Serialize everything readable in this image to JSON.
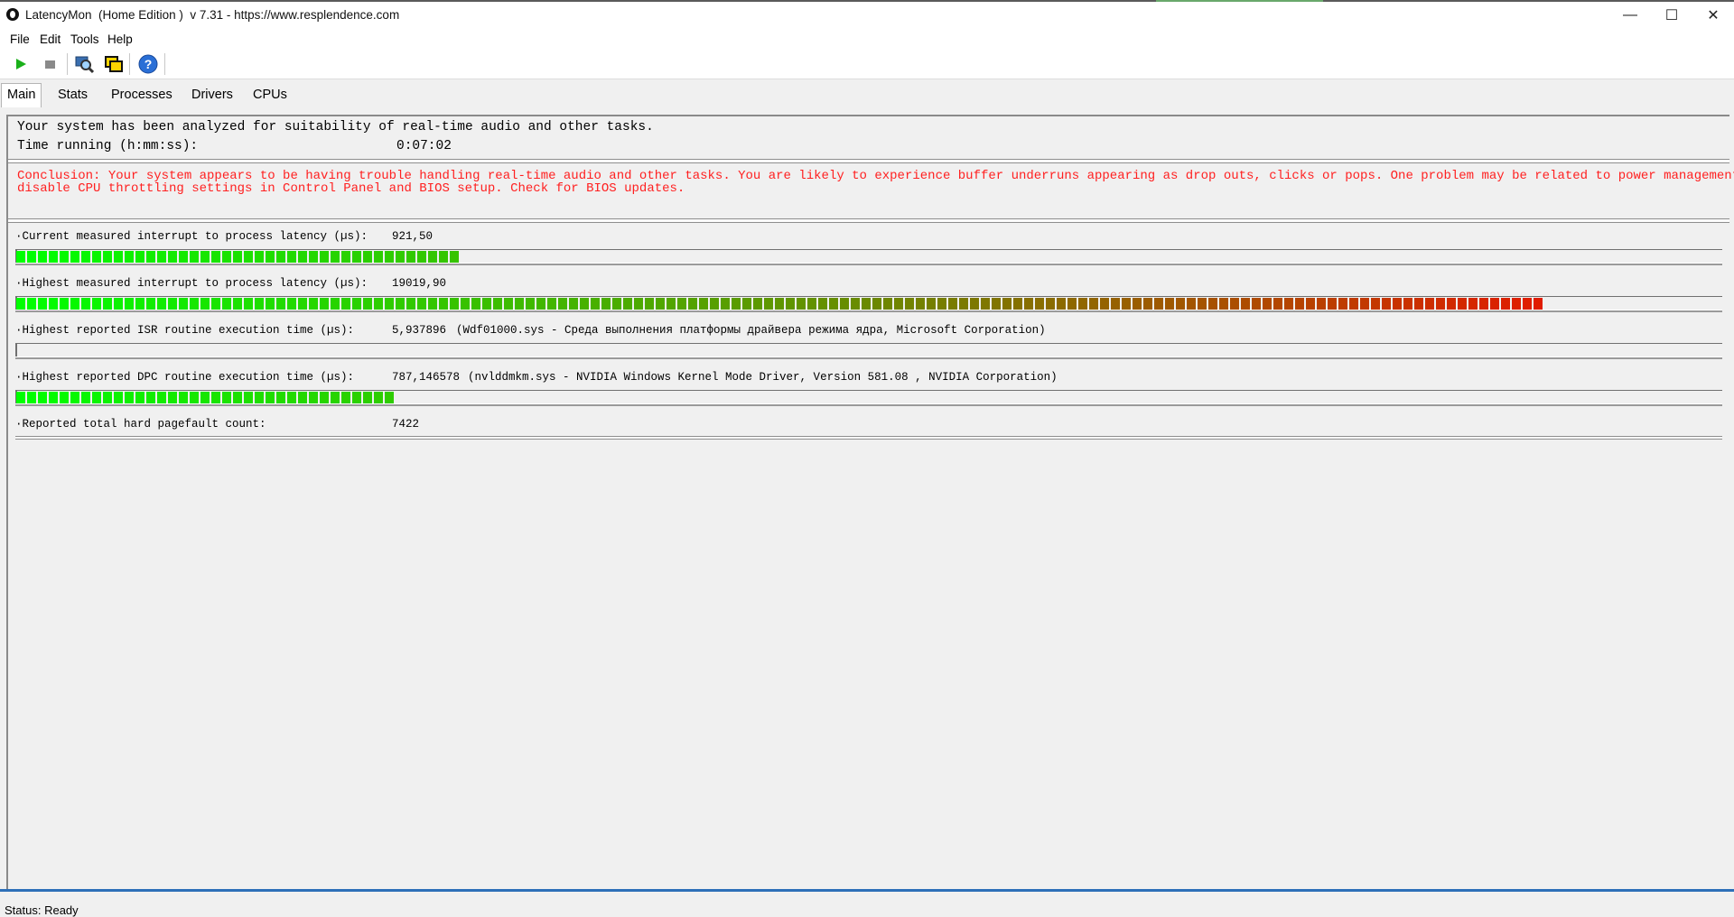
{
  "window": {
    "title": "LatencyMon  (Home Edition )  v 7.31 - https://www.resplendence.com",
    "minimize_glyph": "—",
    "maximize_glyph": "☐",
    "close_glyph": "✕"
  },
  "menu": {
    "items": [
      "File",
      "Edit",
      "Tools",
      "Help"
    ]
  },
  "toolbar": {
    "buttons": [
      "play-icon",
      "stop-icon",
      "magnifier-icon",
      "windows-icon",
      "help-icon"
    ],
    "colors": {
      "play": "#1ab01a",
      "stop": "#8a8a8a",
      "help": "#2a6fd6"
    }
  },
  "tabs": {
    "items": [
      "Main",
      "Stats",
      "Processes",
      "Drivers",
      "CPUs"
    ],
    "active": "Main"
  },
  "summary": {
    "analyzed_text": "Your system has been analyzed for suitability of real-time audio and other tasks.",
    "time_label": "Time running (h:mm:ss):",
    "time_value": "0:07:02",
    "conclusion_line1": "Conclusion: Your system appears to be having trouble handling real-time audio and other tasks. You are likely to experience buffer underruns appearing as drop outs, clicks or pops. One problem may be related to power management,",
    "conclusion_line2": "disable CPU throttling settings in Control Panel and BIOS setup. Check for BIOS updates.",
    "conclusion_color": "#ff2020"
  },
  "metrics": [
    {
      "label": "·Current measured interrupt to process latency (µs):",
      "value": "921,50",
      "detail": "",
      "bar_fraction": 0.263
    },
    {
      "label": "·Highest measured interrupt to process latency (µs):",
      "value": "19019,90",
      "detail": "",
      "bar_fraction": 0.898
    },
    {
      "label": "·Highest reported ISR routine execution time (µs):",
      "value": "5,937896",
      "detail": "(Wdf01000.sys - Среда выполнения платформы драйвера режима ядра, Microsoft Corporation)",
      "bar_fraction": 0.0
    },
    {
      "label": "·Highest reported DPC routine execution time (µs):",
      "value": "787,146578",
      "detail": "(nvlddmkm.sys - NVIDIA Windows Kernel Mode Driver, Version 581.08 , NVIDIA Corporation)",
      "bar_fraction": 0.224
    },
    {
      "label": "·Reported total hard pagefault count:",
      "value": "7422",
      "detail": "",
      "bar_fraction": null
    }
  ],
  "bar_colors": {
    "low": "#00ff00",
    "mid": "#6a8a00",
    "high": "#ff0000"
  },
  "status": {
    "text": "Status: Ready"
  }
}
